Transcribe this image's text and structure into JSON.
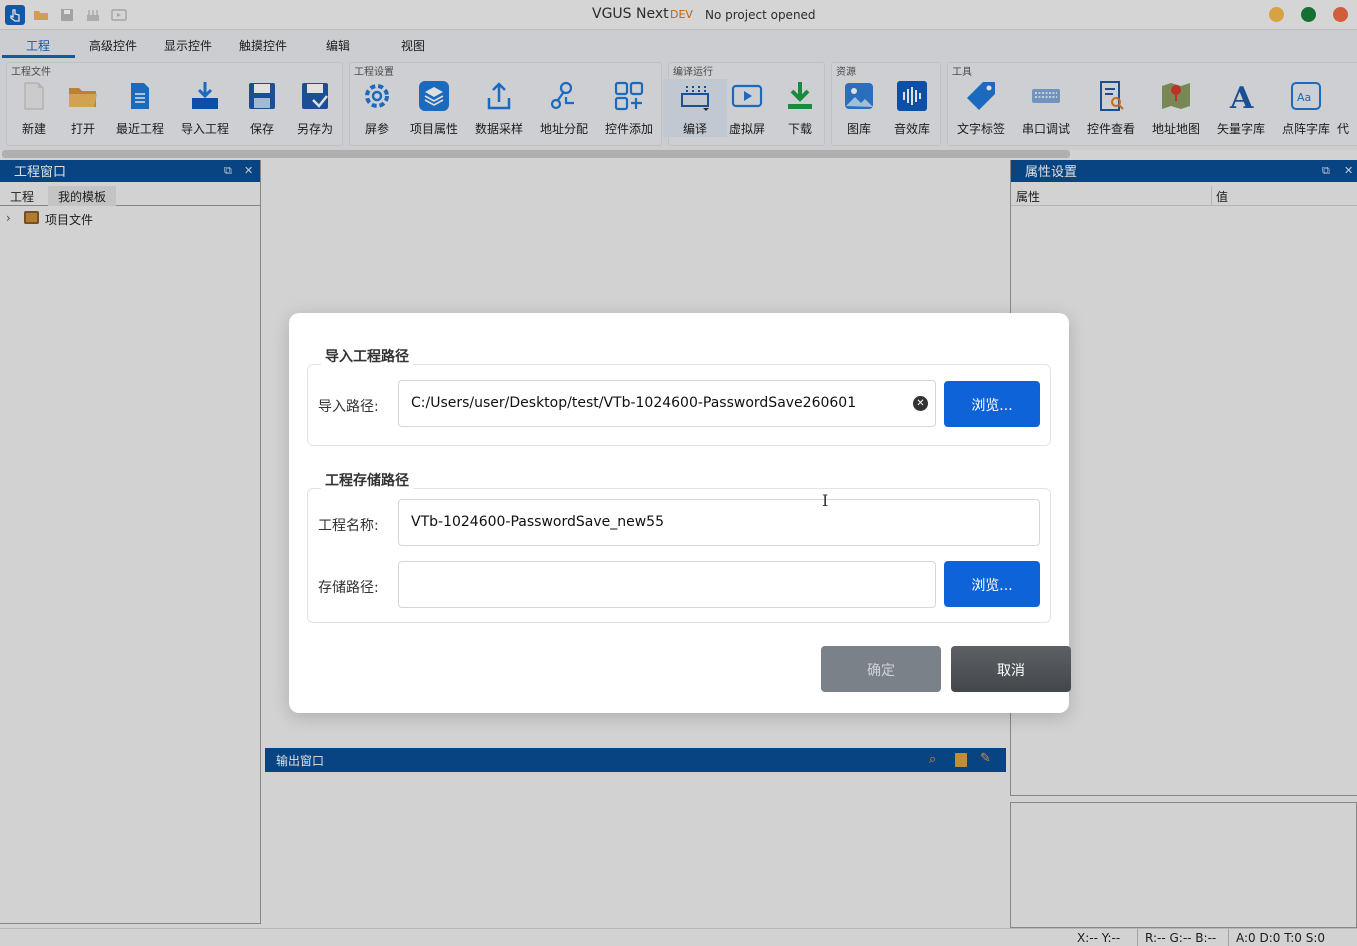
{
  "window": {
    "title": "VGUS Next",
    "dev_badge": "DEV",
    "status": "No project opened",
    "controls": {
      "minimize_color": "#f5b94c",
      "maximize_color": "#1a7f3c",
      "close_color": "#ee6a44"
    }
  },
  "menu": {
    "tabs": [
      "工程",
      "高级控件",
      "显示控件",
      "触摸控件",
      "编辑",
      "视图"
    ],
    "active": "工程"
  },
  "ribbon": {
    "groups": [
      {
        "label": "工程文件",
        "buttons": [
          {
            "label": "新建",
            "icon": "new-file-icon"
          },
          {
            "label": "打开",
            "icon": "open-folder-icon"
          },
          {
            "label": "最近工程",
            "icon": "recent-project-icon"
          },
          {
            "label": "导入工程",
            "icon": "import-project-icon"
          },
          {
            "label": "保存",
            "icon": "save-icon"
          },
          {
            "label": "另存为",
            "icon": "save-as-icon"
          }
        ]
      },
      {
        "label": "工程设置",
        "buttons": [
          {
            "label": "屏参",
            "icon": "gear-icon"
          },
          {
            "label": "项目属性",
            "icon": "layers-icon"
          },
          {
            "label": "数据采样",
            "icon": "upload-icon"
          },
          {
            "label": "地址分配",
            "icon": "address-icon"
          },
          {
            "label": "控件添加",
            "icon": "add-widget-icon"
          }
        ]
      },
      {
        "label": "编译运行",
        "buttons": [
          {
            "label": "编译",
            "icon": "compile-icon"
          },
          {
            "label": "虚拟屏",
            "icon": "virtual-screen-icon"
          },
          {
            "label": "下载",
            "icon": "download-icon"
          }
        ]
      },
      {
        "label": "资源",
        "buttons": [
          {
            "label": "图库",
            "icon": "image-library-icon"
          },
          {
            "label": "音效库",
            "icon": "audio-library-icon"
          }
        ]
      },
      {
        "label": "工具",
        "buttons": [
          {
            "label": "文字标签",
            "icon": "tag-icon"
          },
          {
            "label": "串口调试",
            "icon": "keyboard-icon"
          },
          {
            "label": "控件查看",
            "icon": "inspect-icon"
          },
          {
            "label": "地址地图",
            "icon": "map-icon"
          },
          {
            "label": "矢量字库",
            "icon": "vector-font-icon"
          },
          {
            "label": "点阵字库",
            "icon": "bitmap-font-icon"
          },
          {
            "label": "代",
            "icon": "code-icon"
          }
        ]
      }
    ]
  },
  "left_panel": {
    "title": "工程窗口",
    "tabs": [
      "工程",
      "我的模板"
    ],
    "tree": [
      {
        "label": "项目文件"
      }
    ]
  },
  "right_panel": {
    "title": "属性设置",
    "columns": [
      "属性",
      "值"
    ]
  },
  "output": {
    "title": "输出窗口"
  },
  "statusbar": {
    "xy": "X:--  Y:--",
    "rgb": "R:-- G:-- B:--",
    "counters": "A:0  D:0  T:0  S:0"
  },
  "dialog": {
    "import_section": {
      "legend": "导入工程路径",
      "path_label": "导入路径:",
      "path_value": "C:/Users/user/Desktop/test/VTb-1024600-PasswordSave260601",
      "browse_label": "浏览..."
    },
    "storage_section": {
      "legend": "工程存储路径",
      "name_label": "工程名称:",
      "name_value": "VTb-1024600-PasswordSave_new55",
      "path_label": "存储路径:",
      "path_value": "",
      "browse_label": "浏览..."
    },
    "ok_label": "确定",
    "cancel_label": "取消"
  }
}
